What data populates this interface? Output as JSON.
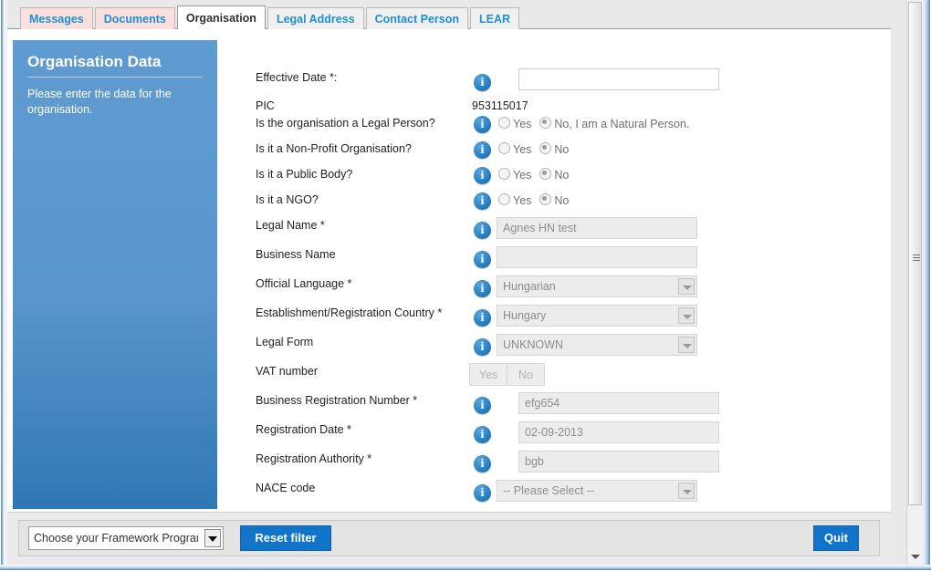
{
  "tabs": [
    {
      "label": "Messages",
      "state": "pink"
    },
    {
      "label": "Documents",
      "state": "pink"
    },
    {
      "label": "Organisation",
      "state": "active"
    },
    {
      "label": "Legal Address",
      "state": "plain"
    },
    {
      "label": "Contact Person",
      "state": "plain"
    },
    {
      "label": "LEAR",
      "state": "plain"
    }
  ],
  "sidebar": {
    "title": "Organisation Data",
    "description": "Please enter the data for the organisation."
  },
  "form": {
    "effective_date": {
      "label": "Effective Date *:",
      "value": "",
      "icon": "info-icon"
    },
    "pic": {
      "label": "PIC",
      "value": "953115017"
    },
    "legal_person": {
      "label": "Is the organisation a Legal Person?",
      "yes": "Yes",
      "no": "No, I am a Natural Person.",
      "selected": "no"
    },
    "non_profit": {
      "label": "Is it a Non-Profit Organisation?",
      "yes": "Yes",
      "no": "No",
      "selected": "no"
    },
    "public_body": {
      "label": "Is it a Public Body?",
      "yes": "Yes",
      "no": "No",
      "selected": "no"
    },
    "ngo": {
      "label": "Is it a NGO?",
      "yes": "Yes",
      "no": "No",
      "selected": "no"
    },
    "legal_name": {
      "label": "Legal Name *",
      "value": "Agnes HN test"
    },
    "business_name": {
      "label": "Business Name",
      "value": ""
    },
    "official_language": {
      "label": "Official Language *",
      "value": "Hungarian"
    },
    "establishment_country": {
      "label": "Establishment/Registration Country *",
      "value": "Hungary"
    },
    "legal_form": {
      "label": "Legal Form",
      "value": "UNKNOWN"
    },
    "vat_number": {
      "label": "VAT number",
      "yes": "Yes",
      "no": "No"
    },
    "business_registration_number": {
      "label": "Business Registration Number *",
      "value": "efg654"
    },
    "registration_date": {
      "label": "Registration Date *",
      "value": "02-09-2013"
    },
    "registration_authority": {
      "label": "Registration Authority *",
      "value": "bgb"
    },
    "nace_code": {
      "label": "NACE code",
      "value": "-- Please Select --"
    }
  },
  "bottom_bar": {
    "framework_select": "Choose your Framework Programme",
    "reset_filter": "Reset filter",
    "quit": "Quit"
  },
  "colors": {
    "accent_blue": "#1274c8",
    "tab_link": "#1f8fd4",
    "tab_pink": "#fbdfdc",
    "sidebar_blue": "#5f9ad1",
    "info_icon": "#2e86c8"
  }
}
